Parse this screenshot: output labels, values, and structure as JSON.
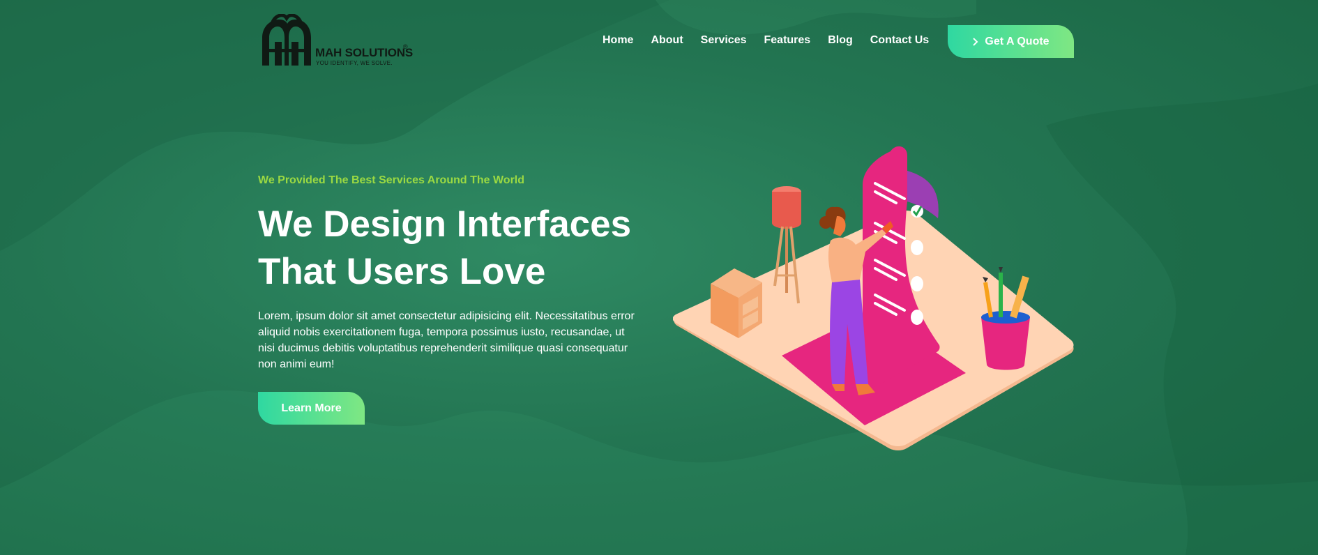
{
  "brand": {
    "name": "MAH SOLUTIONS",
    "tagline": "YOU IDENTIFY, WE SOLVE.",
    "reg": "®"
  },
  "nav": {
    "items": [
      "Home",
      "About",
      "Services",
      "Features",
      "Blog",
      "Contact Us"
    ]
  },
  "header": {
    "quote_label": "Get A Quote",
    "quote_icon": "chevron-right-icon"
  },
  "hero": {
    "subtitle": "We Provided The Best Services Around The World",
    "headline_line1": "We Design Interfaces",
    "headline_line2": "That Users Love",
    "description": "Lorem, ipsum dolor sit amet consectetur adipisicing elit. Necessitatibus error aliquid nobis exercitationem fuga, tempora possimus iusto, recusandae, ut nisi ducimus debitis voluptatibus reprehenderit similique quasi consequatur non animi eum!",
    "cta_label": "Learn More"
  },
  "colors": {
    "background": "#237552",
    "accent_start": "#2fd8a1",
    "accent_end": "#7fe783",
    "subtitle": "#9bd942",
    "checklist_pink": "#e6267f"
  }
}
